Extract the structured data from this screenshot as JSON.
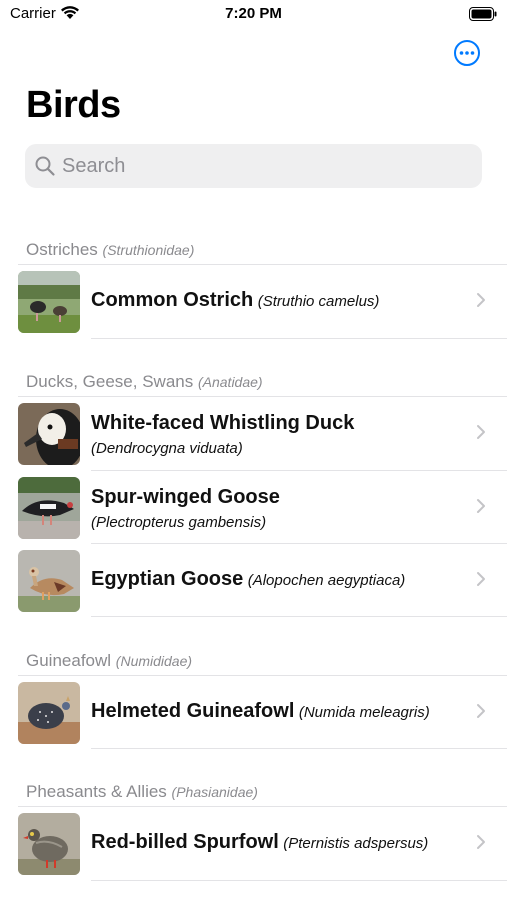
{
  "status": {
    "carrier": "Carrier",
    "time": "7:20 PM"
  },
  "header": {
    "title": "Birds",
    "more_icon": "ellipsis-circle-icon"
  },
  "search": {
    "placeholder": "Search"
  },
  "sections": [
    {
      "title": "Ostriches",
      "family": "(Struthionidae)",
      "items": [
        {
          "name": "Common Ostrich",
          "scientific": "(Struthio camelus)"
        }
      ]
    },
    {
      "title": "Ducks, Geese, Swans",
      "family": "(Anatidae)",
      "items": [
        {
          "name": "White-faced Whistling Duck",
          "scientific": "(Dendrocygna viduata)"
        },
        {
          "name": "Spur-winged Goose",
          "scientific": "(Plectropterus gambensis)"
        },
        {
          "name": "Egyptian Goose",
          "scientific": "(Alopochen aegyptiaca)"
        }
      ]
    },
    {
      "title": "Guineafowl",
      "family": "(Numididae)",
      "items": [
        {
          "name": "Helmeted Guineafowl",
          "scientific": "(Numida meleagris)"
        }
      ]
    },
    {
      "title": "Pheasants & Allies",
      "family": "(Phasianidae)",
      "items": [
        {
          "name": "Red-billed Spurfowl",
          "scientific": "(Pternistis adspersus)"
        }
      ]
    }
  ],
  "colors": {
    "accent": "#007aff",
    "secondary_text": "#8a8a8e",
    "search_bg": "#efeff0",
    "separator": "#e3e3e6"
  }
}
